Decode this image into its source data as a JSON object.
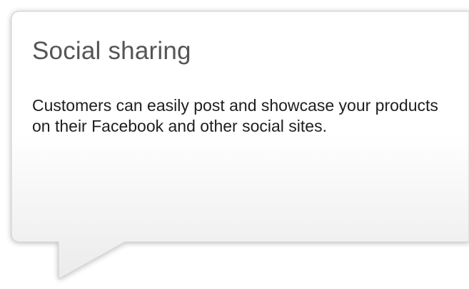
{
  "card": {
    "title": "Social sharing",
    "description": "Customers can easily post and showcase your products on their Facebook and other social sites."
  },
  "colors": {
    "card_top": "#ffffff",
    "card_bottom": "#ececec",
    "border": "#d0d0d0",
    "title": "#555555",
    "text": "#1e1e1e"
  }
}
